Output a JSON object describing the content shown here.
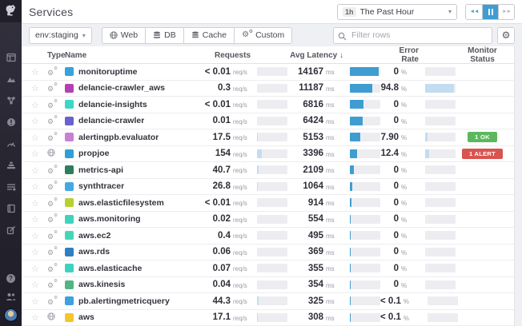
{
  "app": {
    "name": "Datadog",
    "logo_icon": "datadog-bits-logo"
  },
  "sidebar": {
    "nav_items": [
      "dashboards",
      "infrastructure",
      "host-map",
      "events",
      "metrics",
      "apm",
      "monitors",
      "logs",
      "notebooks"
    ],
    "bottom_items": [
      "help",
      "team",
      "user-avatar"
    ]
  },
  "header": {
    "title": "Services",
    "time_picker": {
      "shortcut": "1h",
      "label": "The Past Hour"
    },
    "controls": {
      "rewind": "rewind",
      "pause": "pause",
      "forward": "forward",
      "active": "pause"
    }
  },
  "toolbar": {
    "env_filter": {
      "label": "env:staging"
    },
    "type_filters": [
      {
        "label": "Web",
        "icon": "globe-icon"
      },
      {
        "label": "DB",
        "icon": "database-icon"
      },
      {
        "label": "Cache",
        "icon": "cache-icon"
      },
      {
        "label": "Custom",
        "icon": "gears-icon"
      }
    ],
    "search": {
      "placeholder": "Filter rows"
    },
    "settings_icon": "gear-icon"
  },
  "table": {
    "columns": {
      "type": "Type",
      "name": "Name",
      "requests": "Requests",
      "latency": "Avg Latency",
      "error": "Error Rate",
      "monitor": "Monitor Status"
    },
    "sort": {
      "column": "latency",
      "direction": "desc",
      "arrow": "↓"
    },
    "units": {
      "requests": "req/s",
      "latency": "ms",
      "error": "%"
    },
    "scales": {
      "requests_max": 1000,
      "latency_max": 15000,
      "error_max": 100
    },
    "rows": [
      {
        "type": "custom",
        "color": "#36a3dc",
        "name": "monitoruptime",
        "requests": "< 0.01",
        "requests_value": 0.005,
        "latency": "14167",
        "latency_value": 14167,
        "error": "0",
        "error_value": 0,
        "monitor": null
      },
      {
        "type": "custom",
        "color": "#b341b4",
        "name": "delancie-crawler_aws",
        "requests": "0.3",
        "requests_value": 0.3,
        "latency": "11187",
        "latency_value": 11187,
        "error": "94.8",
        "error_value": 94.8,
        "monitor": null
      },
      {
        "type": "custom",
        "color": "#3fd6c5",
        "name": "delancie-insights",
        "requests": "< 0.01",
        "requests_value": 0.005,
        "latency": "6816",
        "latency_value": 6816,
        "error": "0",
        "error_value": 0,
        "monitor": null
      },
      {
        "type": "custom",
        "color": "#6a61cf",
        "name": "delancie-crawler",
        "requests": "0.01",
        "requests_value": 0.01,
        "latency": "6424",
        "latency_value": 6424,
        "error": "0",
        "error_value": 0,
        "monitor": null
      },
      {
        "type": "custom",
        "color": "#c97fd6",
        "name": "alertingpb.evaluator",
        "requests": "17.5",
        "requests_value": 17.5,
        "latency": "5153",
        "latency_value": 5153,
        "error": "7.90",
        "error_value": 7.9,
        "monitor": {
          "label": "1 OK",
          "kind": "ok"
        }
      },
      {
        "type": "web",
        "color": "#2f9fd6",
        "name": "propjoe",
        "requests": "154",
        "requests_value": 154,
        "latency": "3396",
        "latency_value": 3396,
        "error": "12.4",
        "error_value": 12.4,
        "monitor": {
          "label": "1 ALERT",
          "kind": "alert"
        }
      },
      {
        "type": "custom",
        "color": "#2e7d5c",
        "name": "metrics-api",
        "requests": "40.7",
        "requests_value": 40.7,
        "latency": "2109",
        "latency_value": 2109,
        "error": "0",
        "error_value": 0,
        "monitor": null
      },
      {
        "type": "custom",
        "color": "#45a9e0",
        "name": "synthtracer",
        "requests": "26.8",
        "requests_value": 26.8,
        "latency": "1064",
        "latency_value": 1064,
        "error": "0",
        "error_value": 0,
        "monitor": null
      },
      {
        "type": "custom",
        "color": "#b8cf33",
        "name": "aws.elasticfilesystem",
        "requests": "< 0.01",
        "requests_value": 0.005,
        "latency": "914",
        "latency_value": 914,
        "error": "0",
        "error_value": 0,
        "monitor": null
      },
      {
        "type": "custom",
        "color": "#3fd2bd",
        "name": "aws.monitoring",
        "requests": "0.02",
        "requests_value": 0.02,
        "latency": "554",
        "latency_value": 554,
        "error": "0",
        "error_value": 0,
        "monitor": null
      },
      {
        "type": "custom",
        "color": "#45d6b8",
        "name": "aws.ec2",
        "requests": "0.4",
        "requests_value": 0.4,
        "latency": "495",
        "latency_value": 495,
        "error": "0",
        "error_value": 0,
        "monitor": null
      },
      {
        "type": "custom",
        "color": "#2e7fc2",
        "name": "aws.rds",
        "requests": "0.06",
        "requests_value": 0.06,
        "latency": "369",
        "latency_value": 369,
        "error": "0",
        "error_value": 0,
        "monitor": null
      },
      {
        "type": "custom",
        "color": "#3ed3c1",
        "name": "aws.elasticache",
        "requests": "0.07",
        "requests_value": 0.07,
        "latency": "355",
        "latency_value": 355,
        "error": "0",
        "error_value": 0,
        "monitor": null
      },
      {
        "type": "custom",
        "color": "#52b482",
        "name": "aws.kinesis",
        "requests": "0.04",
        "requests_value": 0.04,
        "latency": "354",
        "latency_value": 354,
        "error": "0",
        "error_value": 0,
        "monitor": null
      },
      {
        "type": "custom",
        "color": "#3da2dd",
        "name": "pb.alertingmetricquery",
        "requests": "44.3",
        "requests_value": 44.3,
        "latency": "325",
        "latency_value": 325,
        "error": "< 0.1",
        "error_value": 0.05,
        "monitor": null
      },
      {
        "type": "web",
        "color": "#f5c52d",
        "name": "aws",
        "requests": "17.1",
        "requests_value": 17.1,
        "latency": "308",
        "latency_value": 308,
        "error": "< 0.1",
        "error_value": 0.05,
        "monitor": null
      }
    ]
  },
  "colors": {
    "accent_blue": "#3f9dd1",
    "bar_light_blue": "#c2ddf0",
    "ok_green": "#5cb85c",
    "alert_red": "#d9534f"
  }
}
